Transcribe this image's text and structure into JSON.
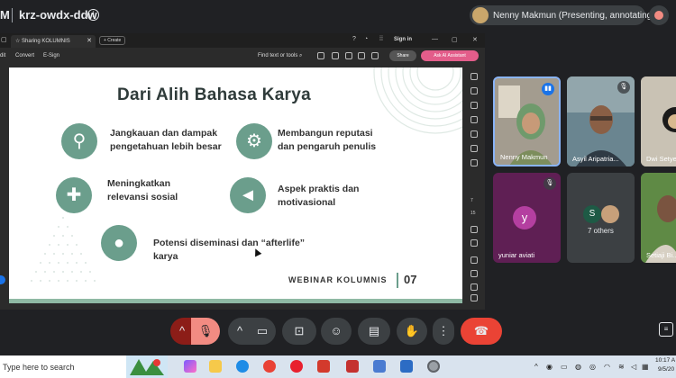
{
  "meet": {
    "logo_letter": "M",
    "meeting_code": "krz-owdx-ddw",
    "info_icon": "info-icon",
    "presenter_label": "Nenny Makmun (Presenting, annotating)"
  },
  "browser": {
    "tab_title": "Sharing KOLUMNIS",
    "new_tab_label": "+ Create",
    "sign_in": "Sign in",
    "toolbar_items": [
      "dit",
      "Convert",
      "E-Sign"
    ],
    "find_label": "Find text or tools",
    "share_label": "Share",
    "ai_label": "Ask AI Assistant",
    "rail_numbers": [
      "7",
      "15"
    ]
  },
  "slide": {
    "title": "Dari Alih Bahasa Karya",
    "items": [
      {
        "text_1": "Jangkauan dan dampak",
        "text_2": "pengetahuan lebih besar",
        "icon": "magnifier-icon"
      },
      {
        "text_1": "Membangun reputasi",
        "text_2": "dan pengaruh penulis",
        "icon": "gears-icon"
      },
      {
        "text_1": "Meningkatkan",
        "text_2": "relevansi sosial",
        "icon": "puzzle-icon"
      },
      {
        "text_1": "Aspek praktis dan",
        "text_2": "motivasional",
        "icon": "megaphone-icon"
      },
      {
        "text_1": "Potensi diseminasi dan “afterlife”",
        "text_2": "karya",
        "icon": "people-icon"
      }
    ],
    "footer_brand": "WEBINAR KOLUMNIS",
    "page_number": "07"
  },
  "participants": [
    {
      "name": "Nenny Makmun"
    },
    {
      "name": "Asyil Aripatria..."
    },
    {
      "name": "Dwi Setye..."
    },
    {
      "name": "yuniar aviati",
      "initial": "y"
    },
    {
      "name": "7 others",
      "initial": "S"
    },
    {
      "name": "Setiaji Bi..."
    }
  ],
  "controls": {
    "raise_chevron": "^",
    "more_dots": "⋮",
    "end_call_icon": "end-call-icon"
  },
  "taskbar": {
    "search_placeholder": "Type here to search",
    "time": "10:17 A",
    "date": "9/5/20"
  },
  "colors": {
    "accent_green": "#6b9e8c",
    "end_call_red": "#ea4335",
    "ai_button_pink": "#e35d8a"
  }
}
